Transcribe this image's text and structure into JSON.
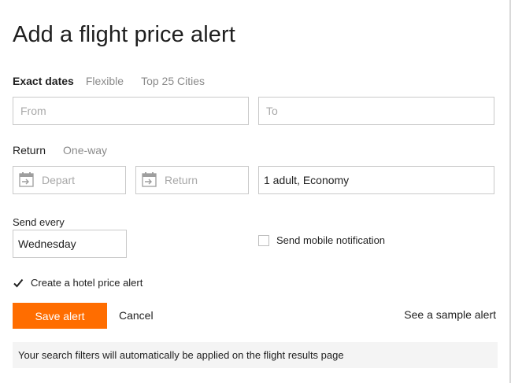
{
  "title": "Add a flight price alert",
  "date_tabs": [
    {
      "label": "Exact dates",
      "active": true
    },
    {
      "label": "Flexible",
      "active": false
    },
    {
      "label": "Top 25 Cities",
      "active": false
    }
  ],
  "from": {
    "placeholder": "From",
    "value": ""
  },
  "to": {
    "placeholder": "To",
    "value": ""
  },
  "trip_tabs": [
    {
      "label": "Return",
      "active": true
    },
    {
      "label": "One-way",
      "active": false
    }
  ],
  "depart": {
    "placeholder": "Depart",
    "icon": "calendar-depart-icon"
  },
  "return_date": {
    "placeholder": "Return",
    "icon": "calendar-return-icon"
  },
  "travellers": {
    "value": "1 adult, Economy"
  },
  "send_every": {
    "label": "Send every",
    "value": "Wednesday"
  },
  "mobile_notification": {
    "label": "Send mobile notification",
    "checked": false
  },
  "hotel_alert": {
    "label": "Create a hotel price alert",
    "checked": true
  },
  "buttons": {
    "save": "Save alert",
    "cancel": "Cancel",
    "sample": "See a sample alert"
  },
  "info": "Your search filters will automatically be applied on the flight results page",
  "colors": {
    "accent": "#ff6d00",
    "border": "#c9c9c9",
    "muted": "#8a8a8a"
  }
}
